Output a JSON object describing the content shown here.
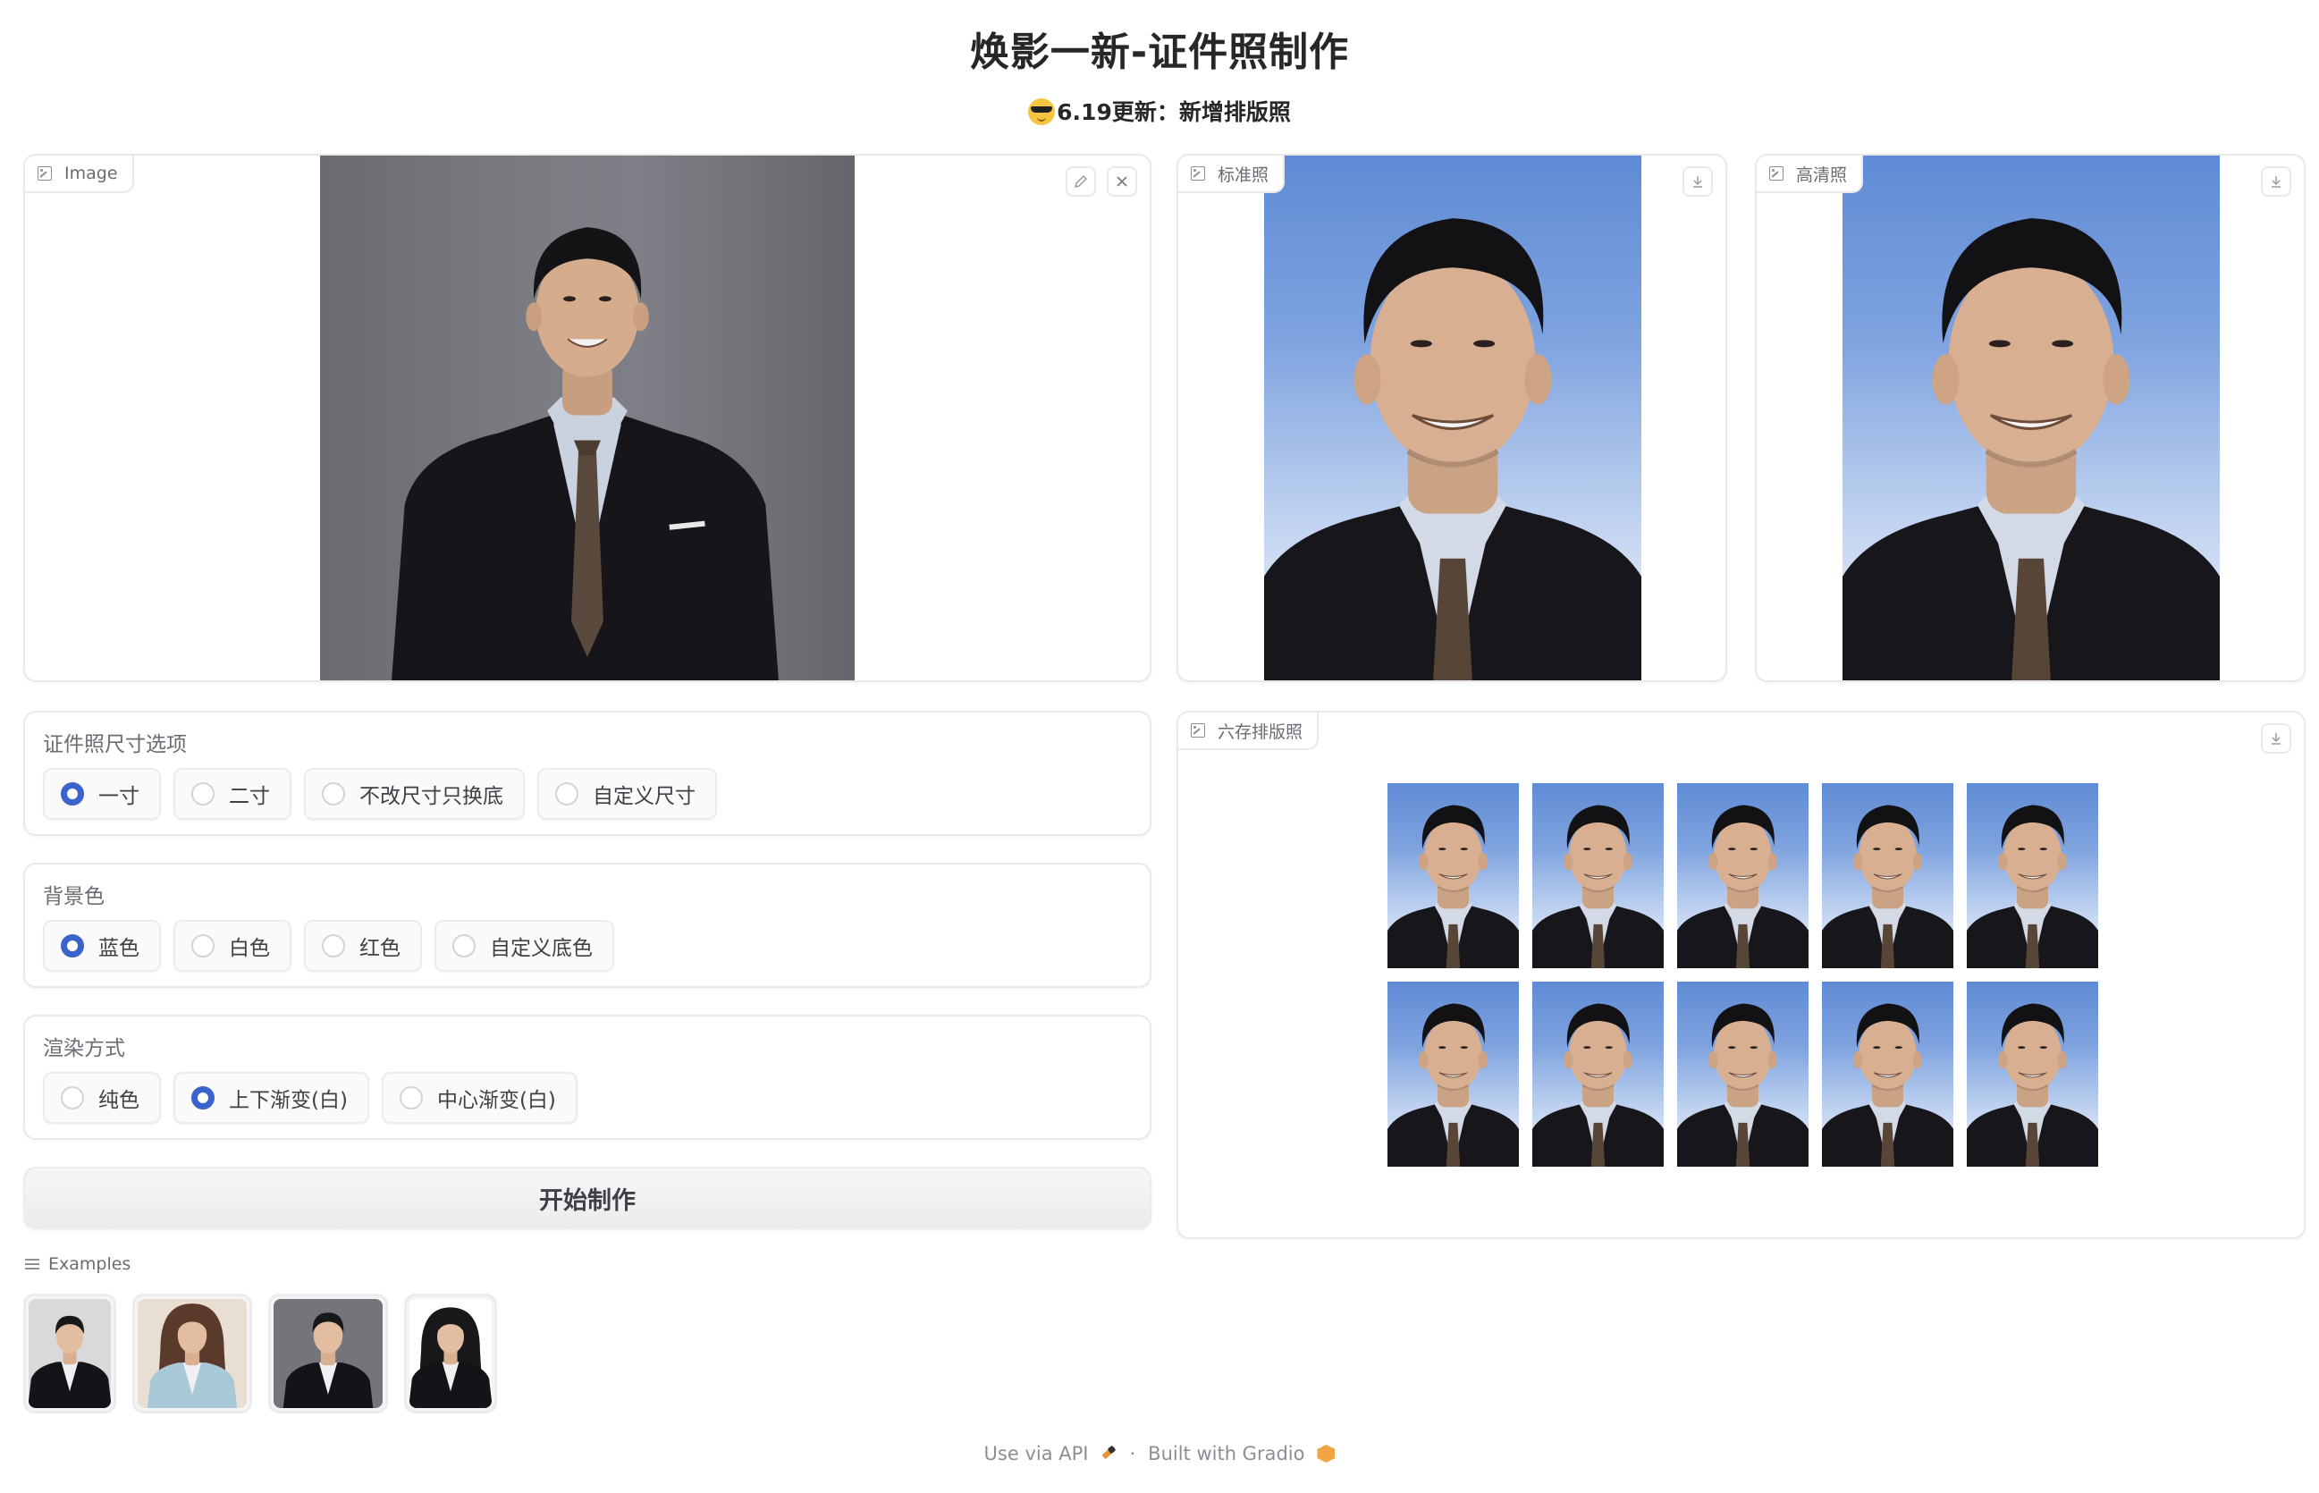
{
  "header": {
    "title": "焕影一新-证件照制作",
    "subtitle_emoji": "smiling-face-with-sunglasses",
    "subtitle": "6.19更新：新增排版照"
  },
  "input_image": {
    "label": "Image",
    "edit_icon": "pencil-icon",
    "clear_icon": "close-icon",
    "background_color": "#74757b"
  },
  "outputs": {
    "standard": {
      "label": "标准照",
      "download_icon": "download-icon"
    },
    "hd": {
      "label": "高清照",
      "download_icon": "download-icon"
    },
    "layout": {
      "label": "六存排版照",
      "download_icon": "download-icon",
      "rows": 2,
      "columns": 5
    }
  },
  "size_options": {
    "label": "证件照尺寸选项",
    "options": [
      "一寸",
      "二寸",
      "不改尺寸只换底",
      "自定义尺寸"
    ],
    "selected": "一寸"
  },
  "bg_color": {
    "label": "背景色",
    "options": [
      "蓝色",
      "白色",
      "红色",
      "自定义底色"
    ],
    "selected": "蓝色"
  },
  "render_mode": {
    "label": "渲染方式",
    "options": [
      "纯色",
      "上下渐变(白)",
      "中心渐变(白)"
    ],
    "selected": "上下渐变(白)"
  },
  "start_button": {
    "label": "开始制作"
  },
  "examples": {
    "label": "Examples",
    "items": [
      {
        "name": "example-man-navy-suit",
        "bg": "#d9d9dc"
      },
      {
        "name": "example-woman-light-blue",
        "bg": "#e9ded2"
      },
      {
        "name": "example-man-gray-bg",
        "bg": "#74757b"
      },
      {
        "name": "example-woman-black",
        "bg": "#ffffff"
      }
    ]
  },
  "footer": {
    "api_link": "Use via API",
    "separator": "·",
    "built_with": "Built with Gradio"
  },
  "colors": {
    "accent": "#3b63cc",
    "id_photo_blue_top": "#5f8bd5",
    "id_photo_blue_bottom": "#e2eaf8",
    "border": "#e9e9ec",
    "text_muted": "#6b6b73"
  }
}
